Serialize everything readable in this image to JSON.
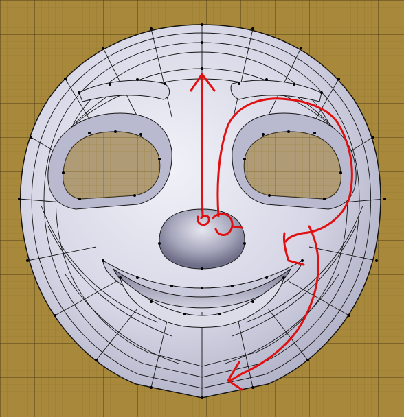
{
  "viewport": {
    "background_color": "#a8883a",
    "grid_minor_color": "#8e7330",
    "grid_major_color": "#4f3f18"
  },
  "mesh": {
    "object": "face-mesh",
    "fill_light": "#f1f1f8",
    "fill_mid": "#c9c9dc",
    "fill_dark": "#8d8da6",
    "wire_color": "#141414",
    "vertex_color": "#000000"
  },
  "annotation": {
    "stroke_color": "#e01010"
  }
}
